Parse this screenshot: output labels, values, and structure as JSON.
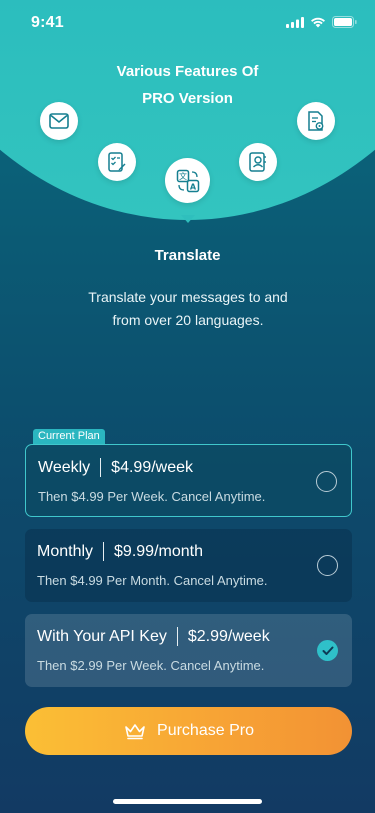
{
  "status_bar": {
    "time": "9:41"
  },
  "features": {
    "title_line1": "Various Features Of",
    "title_line2": "PRO Version",
    "icons": [
      "mail-icon",
      "checklist-edit-icon",
      "translate-icon",
      "contact-book-icon",
      "document-settings-icon"
    ],
    "selected": {
      "name": "Translate",
      "description": "Translate your messages to and from over 20 languages."
    }
  },
  "current_plan_label": "Current Plan",
  "plans": [
    {
      "name": "Weekly",
      "price": "$4.99/week",
      "subtitle": "Then $4.99 Per Week. Cancel Anytime.",
      "checked": false
    },
    {
      "name": "Monthly",
      "price": "$9.99/month",
      "subtitle": "Then $4.99 Per Month. Cancel Anytime.",
      "checked": false
    },
    {
      "name": "With Your API Key",
      "price": "$2.99/week",
      "subtitle": "Then $2.99 Per Week. Cancel Anytime.",
      "checked": true
    }
  ],
  "purchase_button": {
    "label": "Purchase Pro",
    "icon": "crown-icon"
  },
  "colors": {
    "accent": "#2fc0c9",
    "button_start": "#fbbf35",
    "button_end": "#f29234"
  }
}
